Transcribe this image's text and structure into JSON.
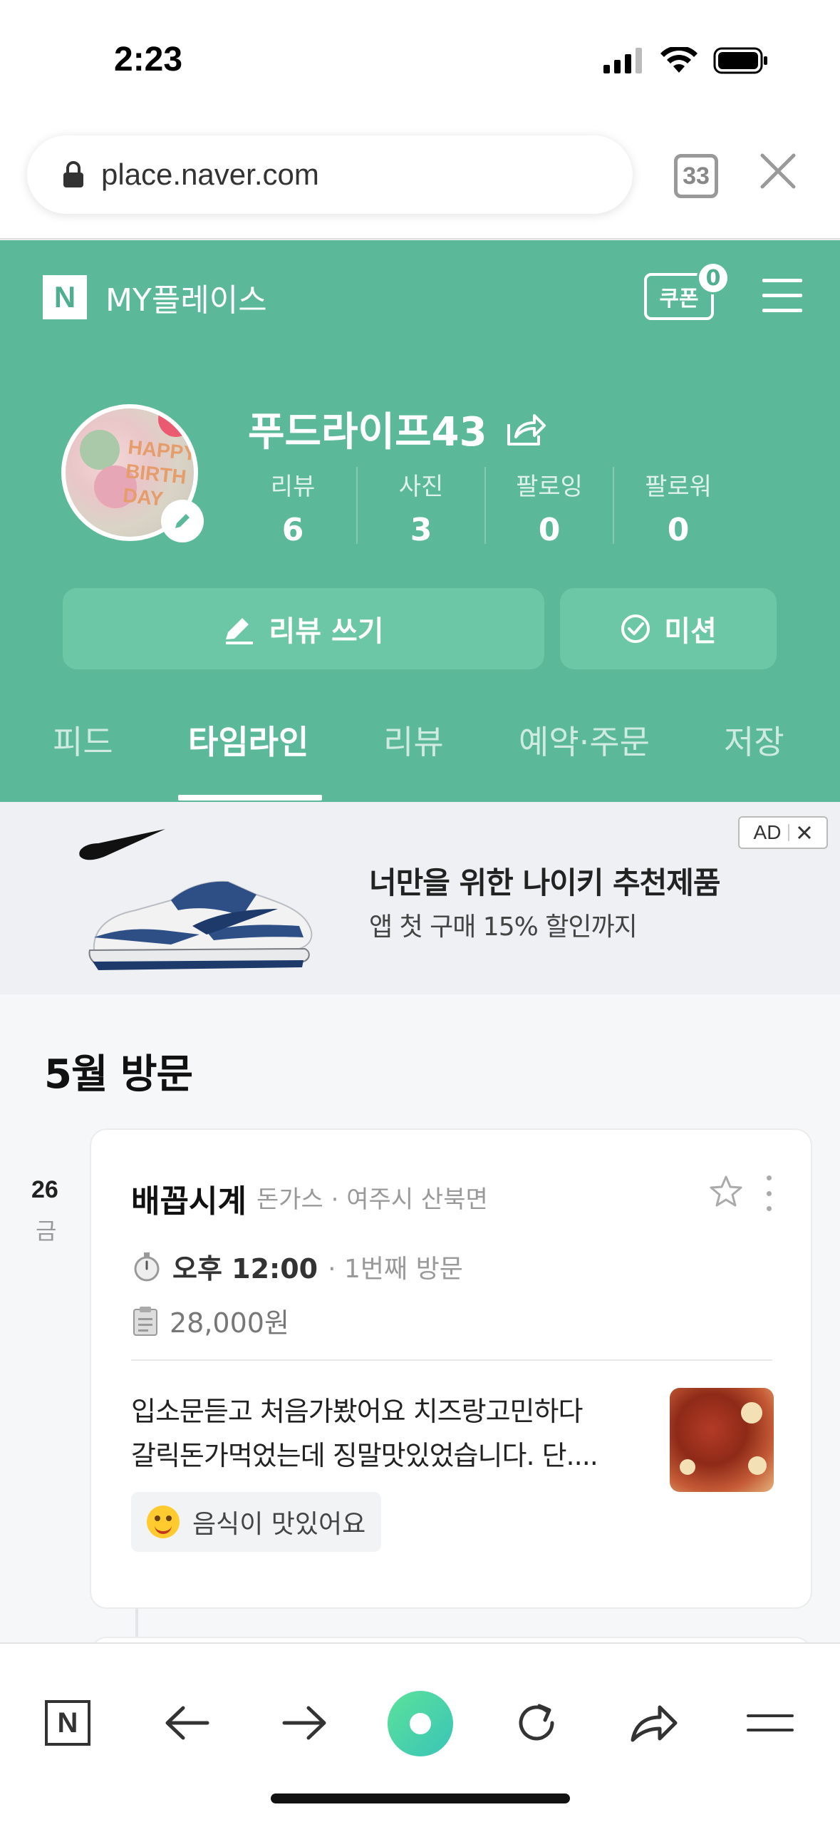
{
  "status_bar": {
    "time": "2:23"
  },
  "browser": {
    "url": "place.naver.com",
    "tab_count": "33"
  },
  "header": {
    "brand": "MY플레이스",
    "logo_letter": "N",
    "coupon_label": "쿠폰",
    "coupon_count": "0"
  },
  "profile": {
    "name": "푸드라이프43",
    "avatar_text": "HAPPY\nBIRTH\nDAY",
    "stats": [
      {
        "label": "리뷰",
        "value": "6"
      },
      {
        "label": "사진",
        "value": "3"
      },
      {
        "label": "팔로잉",
        "value": "0"
      },
      {
        "label": "팔로워",
        "value": "0"
      }
    ],
    "write_review_label": "리뷰 쓰기",
    "mission_label": "미션"
  },
  "tabs": [
    {
      "label": "피드",
      "active": false
    },
    {
      "label": "타임라인",
      "active": true
    },
    {
      "label": "리뷰",
      "active": false
    },
    {
      "label": "예약·주문",
      "active": false
    },
    {
      "label": "저장",
      "active": false
    }
  ],
  "ad": {
    "title": "너만을 위한 나이키 추천제품",
    "subtitle": "앱 첫 구매 15% 할인까지",
    "badge": "AD"
  },
  "timeline": {
    "section_title": "5월 방문",
    "date_day": "26",
    "date_weekday": "금",
    "visit": {
      "place_name": "배꼽시계",
      "category_location": "돈가스 · 여주시 산북면",
      "time": "오후 12:00",
      "visit_count": "· 1번째 방문",
      "price": "28,000원",
      "review_line1": "입소문듣고 처음가봤어요 치즈랑고민하다",
      "review_line2": "갈릭돈가먹었는데 징말맛있었습니다. 단....",
      "keyword": "음식이 맛있어요"
    }
  },
  "colors": {
    "brand_green": "#5bb99a",
    "button_green": "#6cc7a7"
  }
}
